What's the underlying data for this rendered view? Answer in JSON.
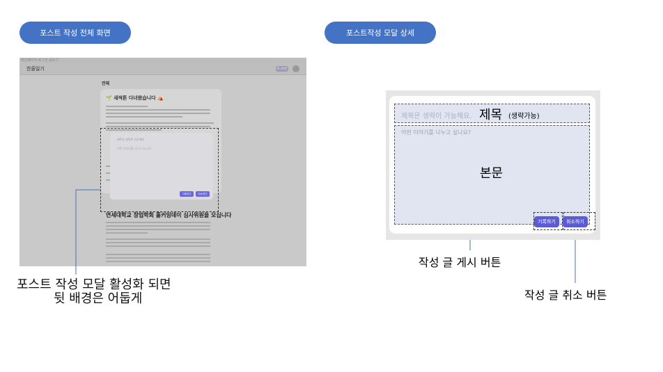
{
  "labels": {
    "full_view": "포스트 작성 전체 화면",
    "detail_view": "포스트작성 모달 상세"
  },
  "full_screen": {
    "breadcrumb": "메인페이지-로그인-글쓰기",
    "brand": "한줄일기",
    "header_button": "로그아웃",
    "feed_label": "전체",
    "post1_title": "🌱 새싹톤 다녀왔습니다 ⛺",
    "post2_title": "연세대학교 창업학회 홀커밍데이 심사위원을 모십니다",
    "modal": {
      "title_placeholder": "제목은 생략이 가능해요",
      "body_placeholder": "어떤 이야기를 나누고 싶나요?",
      "submit": "기록하기",
      "cancel": "취소하기"
    }
  },
  "detail": {
    "title_placeholder": "제목은 생략이 가능해요.",
    "title_annotation": "제목",
    "title_annotation_note": "(생략가능)",
    "body_placeholder": "어떤 이야기를 나누고 싶나요?",
    "body_annotation": "본문",
    "submit_label": "기록하기",
    "cancel_label": "취소하기"
  },
  "annotations": {
    "modal_active_line1": "포스트 작성 모달 활성화 되면",
    "modal_active_line2": "뒷 배경은 어둡게",
    "submit_button_note": "작성 글 게시 버튼",
    "cancel_button_note": "작성 글 취소 버튼"
  },
  "colors": {
    "pill": "#4472c4",
    "modal_button": "#5b5bd6",
    "input_bg": "#e1e5f2"
  }
}
